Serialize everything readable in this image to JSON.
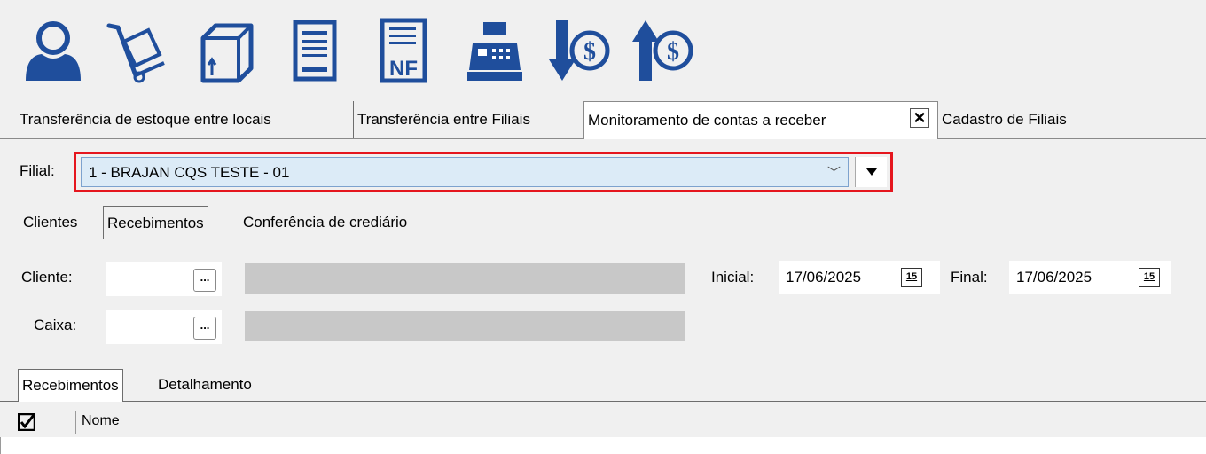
{
  "toolbar": {
    "icons": [
      {
        "name": "user-icon"
      },
      {
        "name": "hand-truck-icon"
      },
      {
        "name": "box-icon"
      },
      {
        "name": "document-icon"
      },
      {
        "name": "invoice-nf-icon",
        "label": "NF"
      },
      {
        "name": "cash-register-icon"
      },
      {
        "name": "dollar-down-icon",
        "label": "$"
      },
      {
        "name": "dollar-up-icon",
        "label": "$"
      }
    ],
    "accent_color": "#1f4e9c"
  },
  "doc_tabs": [
    {
      "label": "Transferência de estoque entre locais"
    },
    {
      "label": "Transferência entre Filiais"
    },
    {
      "label": "Monitoramento de contas a receber",
      "active": true
    },
    {
      "label": "Cadastro de Filiais"
    }
  ],
  "filial": {
    "label": "Filial:",
    "value": "1 - BRAJAN CQS TESTE - 01",
    "highlight_color": "#e5161e"
  },
  "sub_tabs": [
    {
      "label": "Clientes"
    },
    {
      "label": "Recebimentos",
      "active": true
    },
    {
      "label": "Conferência de crediário"
    }
  ],
  "form": {
    "cliente_label": "Cliente:",
    "caixa_label": "Caixa:",
    "ellipsis": "...",
    "inicial_label": "Inicial:",
    "inicial_value": "17/06/2025",
    "final_label": "Final:",
    "final_value": "17/06/2025",
    "calendar_text": "15"
  },
  "inner_tabs": [
    {
      "label": "Recebimentos",
      "active": true
    },
    {
      "label": "Detalhamento"
    }
  ],
  "grid": {
    "columns": [
      "Nome"
    ]
  }
}
